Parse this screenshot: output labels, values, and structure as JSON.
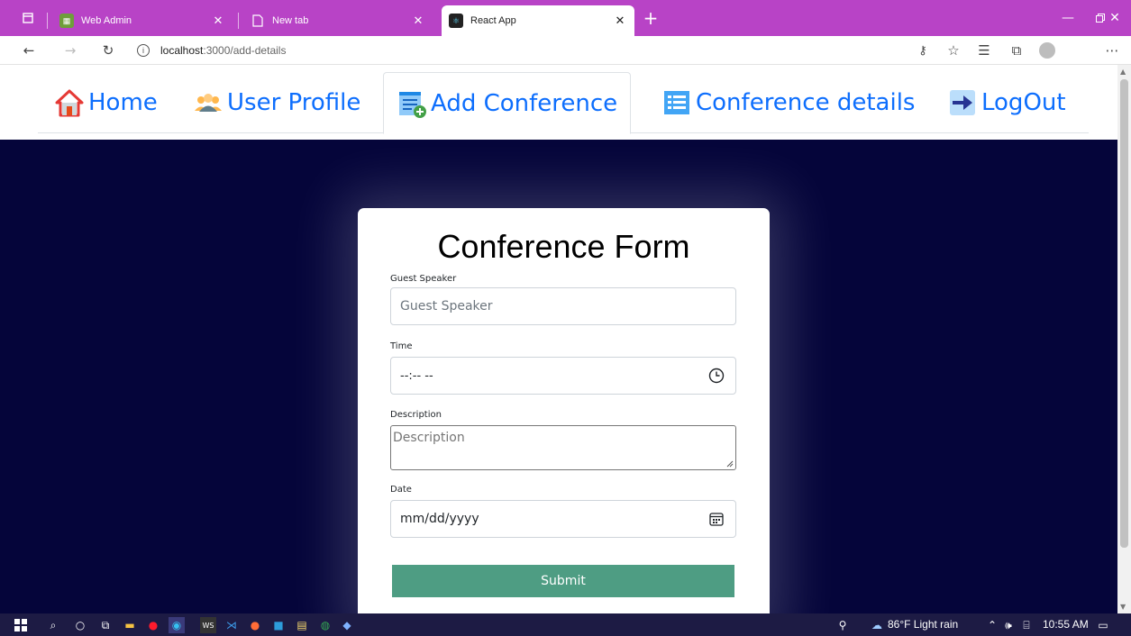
{
  "browser": {
    "tabs": [
      {
        "title": "Web Admin",
        "favicon": "web-admin-icon",
        "active": false
      },
      {
        "title": "New tab",
        "favicon": "page-icon",
        "active": false
      },
      {
        "title": "React App",
        "favicon": "react-icon",
        "active": true
      }
    ],
    "address": {
      "host": "localhost",
      "path": ":3000/add-details"
    },
    "colors": {
      "tabstrip": "#b843c6"
    }
  },
  "nav": {
    "items": [
      {
        "label": "Home",
        "icon": "home-icon"
      },
      {
        "label": "User Profile",
        "icon": "users-icon"
      },
      {
        "label": "Add Conference",
        "icon": "add-document-icon",
        "active": true
      },
      {
        "label": "Conference details",
        "icon": "list-icon"
      },
      {
        "label": "LogOut",
        "icon": "arrow-right-icon"
      }
    ],
    "colors": {
      "link": "#0d6efd"
    }
  },
  "form": {
    "title": "Conference Form",
    "speaker": {
      "label": "Guest Speaker",
      "placeholder": "Guest Speaker"
    },
    "time": {
      "label": "Time",
      "value": "--:-- --"
    },
    "description": {
      "label": "Description",
      "placeholder": "Description"
    },
    "date": {
      "label": "Date",
      "value": "mm/dd/yyyy"
    },
    "submit_label": "Submit",
    "colors": {
      "background": "#05053a",
      "submit": "#4e9d83"
    }
  },
  "taskbar": {
    "weather": "86°F  Light rain",
    "time": "10:55 AM"
  }
}
